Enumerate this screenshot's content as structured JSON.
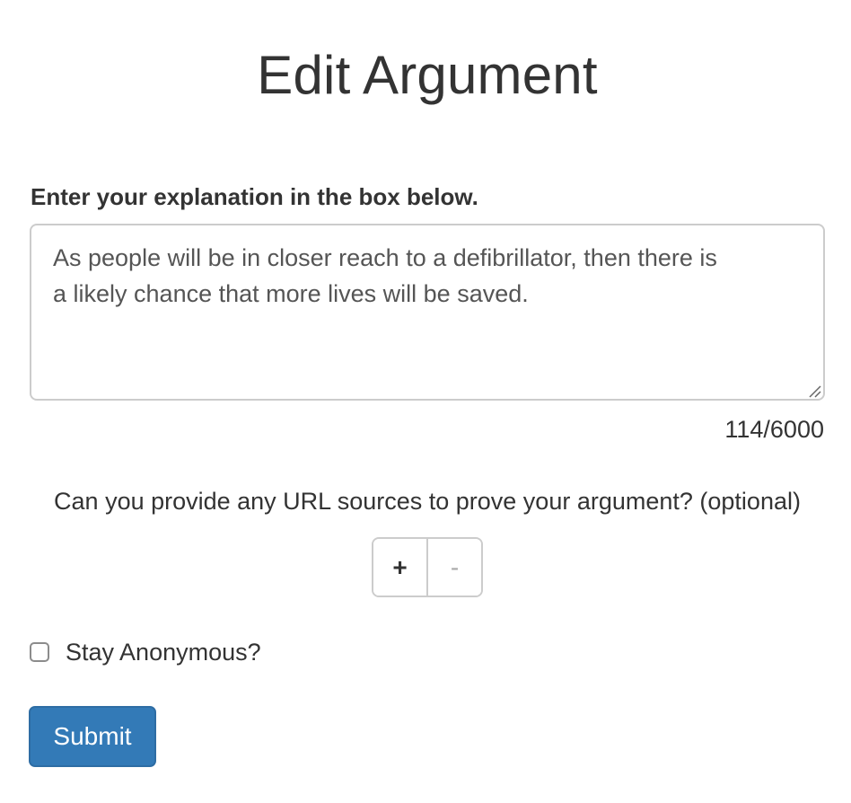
{
  "page": {
    "title": "Edit Argument"
  },
  "explanation": {
    "label": "Enter your explanation in the box below.",
    "value": "As people will be in closer reach to a defibrillator, then there is\na likely chance that more lives will be saved.",
    "char_count": "114/6000"
  },
  "sources": {
    "question": "Can you provide any URL sources to prove your argument? (optional)",
    "add_label": "+",
    "remove_label": "-"
  },
  "anonymous": {
    "label": "Stay Anonymous?",
    "checked": false
  },
  "form": {
    "submit_label": "Submit"
  },
  "colors": {
    "primary": "#337ab7",
    "text": "#333333",
    "border": "#cccccc"
  }
}
